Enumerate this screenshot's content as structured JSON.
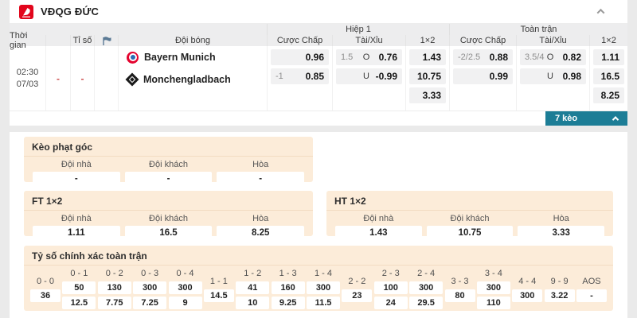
{
  "league": {
    "name": "VĐQG ĐỨC"
  },
  "table": {
    "headers": {
      "time": "Thời gian",
      "score": "Tỉ số",
      "team": "Đội bóng",
      "first_half": "Hiệp 1",
      "full_match": "Toàn trận",
      "handicap": "Cược Chấp",
      "over_under": "Tài/Xỉu",
      "one_x_two": "1×2"
    },
    "match": {
      "time_hour": "02:30",
      "time_date": "07/03",
      "score_home": "-",
      "score_away": "-",
      "home_team": "Bayern Munich",
      "away_team": "Monchengladbach",
      "first_half": {
        "handicap": [
          {
            "line": "",
            "odds": "0.96"
          },
          {
            "line": "-1",
            "odds": "0.85"
          }
        ],
        "over_under": [
          {
            "line": "1.5",
            "side": "O",
            "odds": "0.76"
          },
          {
            "line": "",
            "side": "U",
            "odds": "-0.99"
          }
        ],
        "one_x_two": [
          "1.43",
          "10.75",
          "3.33"
        ]
      },
      "full_match": {
        "handicap": [
          {
            "line": "-2/2.5",
            "odds": "0.88"
          },
          {
            "line": "",
            "odds": "0.99"
          }
        ],
        "over_under": [
          {
            "line": "3.5/4",
            "side": "O",
            "odds": "0.82"
          },
          {
            "line": "",
            "side": "U",
            "odds": "0.98"
          }
        ],
        "one_x_two": [
          "1.11",
          "16.5",
          "8.25"
        ]
      }
    },
    "expand_button": "7 kèo"
  },
  "sections": {
    "corner": {
      "title": "Kèo phạt góc",
      "cols": [
        "Đội nhà",
        "Đội khách",
        "Hòa"
      ],
      "values": [
        "-",
        "-",
        "-"
      ]
    },
    "ft_1x2": {
      "title": "FT 1×2",
      "cols": [
        "Đội nhà",
        "Đội khách",
        "Hòa"
      ],
      "values": [
        "1.11",
        "16.5",
        "8.25"
      ]
    },
    "ht_1x2": {
      "title": "HT 1×2",
      "cols": [
        "Đội nhà",
        "Đội khách",
        "Hòa"
      ],
      "values": [
        "1.43",
        "10.75",
        "3.33"
      ]
    },
    "correct_score": {
      "title": "Tỷ số chính xác toàn trận",
      "cells": [
        {
          "label": "0 - 0",
          "values": [
            "36"
          ]
        },
        {
          "label": "0 - 1",
          "values": [
            "50",
            "12.5"
          ]
        },
        {
          "label": "0 - 2",
          "values": [
            "130",
            "7.75"
          ]
        },
        {
          "label": "0 - 3",
          "values": [
            "300",
            "7.25"
          ]
        },
        {
          "label": "0 - 4",
          "values": [
            "300",
            "9"
          ]
        },
        {
          "label": "1 - 1",
          "values": [
            "14.5"
          ]
        },
        {
          "label": "1 - 2",
          "values": [
            "41",
            "10"
          ]
        },
        {
          "label": "1 - 3",
          "values": [
            "160",
            "9.25"
          ]
        },
        {
          "label": "1 - 4",
          "values": [
            "300",
            "11.5"
          ]
        },
        {
          "label": "2 - 2",
          "values": [
            "23"
          ]
        },
        {
          "label": "2 - 3",
          "values": [
            "100",
            "24"
          ]
        },
        {
          "label": "2 - 4",
          "values": [
            "300",
            "29.5"
          ]
        },
        {
          "label": "3 - 3",
          "values": [
            "80"
          ]
        },
        {
          "label": "3 - 4",
          "values": [
            "300",
            "110"
          ]
        },
        {
          "label": "4 - 4",
          "values": [
            "300"
          ]
        },
        {
          "label": "9 - 9",
          "values": [
            "3.22"
          ]
        },
        {
          "label": "AOS",
          "values": [
            "-"
          ]
        }
      ]
    }
  },
  "colors": {
    "accent_teal": "#1c7d96",
    "league_red": "#e2061c",
    "section_peach": "#fcecd9",
    "dash_red": "#cc4b4b"
  },
  "icons": {
    "league_logo": "bundesliga-logo",
    "header_collapse": "chevron-up-icon",
    "expand": "chevron-up-icon",
    "score_column": "corner-flag-icon"
  }
}
